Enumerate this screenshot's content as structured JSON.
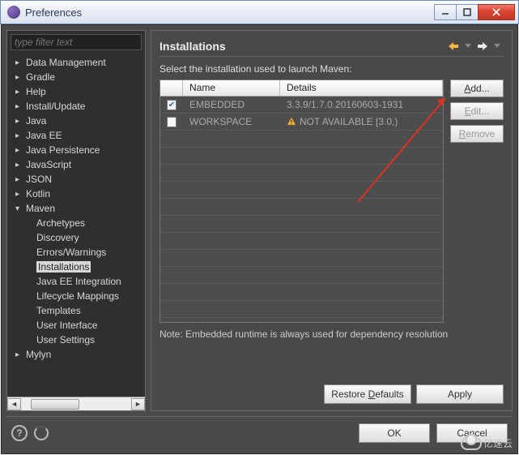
{
  "window": {
    "title": "Preferences"
  },
  "filter": {
    "placeholder": "type filter text"
  },
  "tree": [
    {
      "label": "Data Management",
      "expandable": true,
      "indent": 0
    },
    {
      "label": "Gradle",
      "expandable": true,
      "indent": 0
    },
    {
      "label": "Help",
      "expandable": true,
      "indent": 0
    },
    {
      "label": "Install/Update",
      "expandable": true,
      "indent": 0
    },
    {
      "label": "Java",
      "expandable": true,
      "indent": 0
    },
    {
      "label": "Java EE",
      "expandable": true,
      "indent": 0
    },
    {
      "label": "Java Persistence",
      "expandable": true,
      "indent": 0
    },
    {
      "label": "JavaScript",
      "expandable": true,
      "indent": 0
    },
    {
      "label": "JSON",
      "expandable": true,
      "indent": 0
    },
    {
      "label": "Kotlin",
      "expandable": true,
      "indent": 0
    },
    {
      "label": "Maven",
      "expandable": true,
      "indent": 0,
      "expanded": true
    },
    {
      "label": "Archetypes",
      "expandable": false,
      "indent": 1
    },
    {
      "label": "Discovery",
      "expandable": false,
      "indent": 1
    },
    {
      "label": "Errors/Warnings",
      "expandable": false,
      "indent": 1
    },
    {
      "label": "Installations",
      "expandable": false,
      "indent": 1,
      "selected": true
    },
    {
      "label": "Java EE Integration",
      "expandable": false,
      "indent": 1
    },
    {
      "label": "Lifecycle Mappings",
      "expandable": false,
      "indent": 1
    },
    {
      "label": "Templates",
      "expandable": false,
      "indent": 1
    },
    {
      "label": "User Interface",
      "expandable": false,
      "indent": 1
    },
    {
      "label": "User Settings",
      "expandable": false,
      "indent": 1
    },
    {
      "label": "Mylyn",
      "expandable": true,
      "indent": 0
    }
  ],
  "page": {
    "title": "Installations",
    "subtitle": "Select the installation used to launch Maven:",
    "columns": {
      "name": "Name",
      "details": "Details"
    },
    "rows": [
      {
        "checked": true,
        "name": "EMBEDDED",
        "details": "3.3.9/1.7.0.20160603-1931",
        "warn": false
      },
      {
        "checked": false,
        "name": "WORKSPACE",
        "details": "NOT AVAILABLE [3.0,)",
        "warn": true
      }
    ],
    "note": "Note: Embedded runtime is always used for dependency resolution",
    "buttons": {
      "add": "Add...",
      "edit": "Edit...",
      "remove": "Remove",
      "restore": "Restore Defaults",
      "apply": "Apply"
    }
  },
  "footer": {
    "ok": "OK",
    "cancel": "Cancel"
  },
  "watermark": "亿速云"
}
